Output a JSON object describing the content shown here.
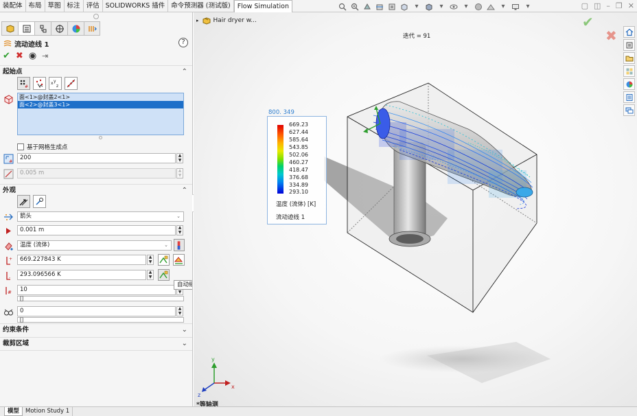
{
  "ribbon": {
    "tabs": [
      "装配体",
      "布局",
      "草图",
      "标注",
      "评估",
      "SOLIDWORKS 插件",
      "命令预测器 (测试版)",
      "Flow Simulation"
    ],
    "active_tab": "Flow Simulation"
  },
  "property_manager": {
    "title": "流动迹线 1",
    "help": "?",
    "actions": {
      "ok": "✔",
      "cancel": "✖",
      "preview": "◉",
      "pin": "⇥"
    },
    "start_points": {
      "header": "起始点",
      "faces": [
        "面<1>@封盖2<1>",
        "面<2>@封盖3<1>"
      ],
      "selected_index": 1,
      "generate_on_mesh_label": "基于网格生成点",
      "generate_on_mesh_checked": false,
      "point_count": "200",
      "spacing": "0.005 m"
    },
    "appearance": {
      "header": "外观",
      "draw_style": "箭头",
      "arrow_size": "0.001 m",
      "color_by": "温度 (流体)",
      "max_value": "669.227843 K",
      "min_value": "293.096566 K",
      "levels": "10",
      "transparency": "0"
    },
    "constraints_header": "约束条件",
    "clip_header": "裁剪区域",
    "tooltip": "自动缩放至全局最大值"
  },
  "viewport": {
    "tree_node": "Hair dryer w...",
    "iteration": "迭代 = 91",
    "view_name": "*等轴测",
    "legend": {
      "max_label": "800. 349",
      "ticks": [
        "669.23",
        "627.44",
        "585.64",
        "543.85",
        "502.06",
        "460.27",
        "418.47",
        "376.68",
        "334.89",
        "293.10"
      ],
      "unit_label": "温度 (流体) [K]",
      "name": "流动迹线 1",
      "colors": {
        "hot": "#e00000",
        "cold": "#0000d8"
      }
    },
    "triad": {
      "x": "x",
      "y": "y",
      "z": "z"
    }
  },
  "bottom_tabs": [
    "模型",
    "Motion Study 1"
  ],
  "active_bottom_tab": "模型",
  "colors": {
    "accept": "#8bc77a",
    "reject": "#e6948b",
    "selection": "#1d6fc9",
    "legend_border": "#8db4e0"
  }
}
